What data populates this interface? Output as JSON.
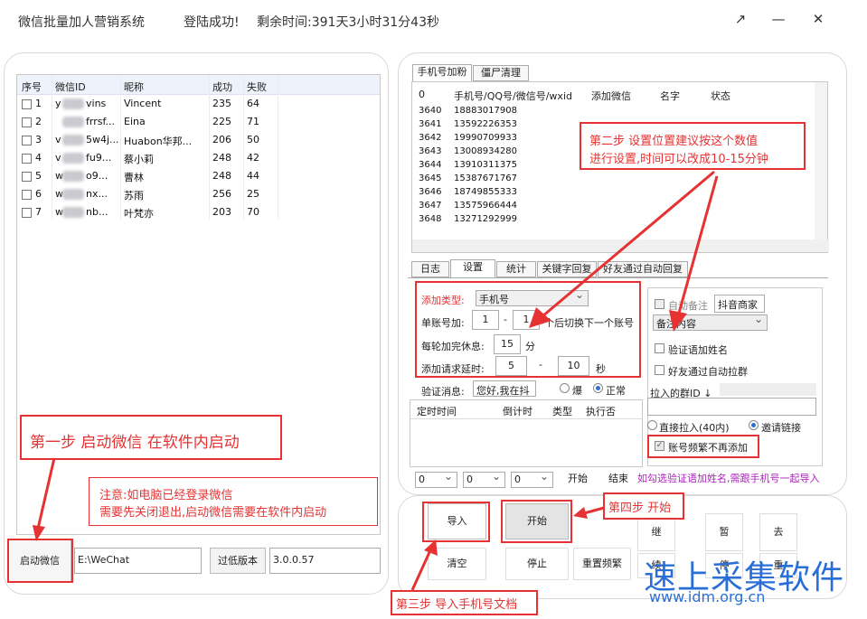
{
  "title": {
    "app": "微信批量加人营销系统",
    "login": "登陆成功!",
    "remaining": "剩余时间:391天3小时31分43秒"
  },
  "winctl": {
    "restore": "↗",
    "min": "—",
    "close": "✕"
  },
  "left_table": {
    "headers": [
      "序号",
      "微信ID",
      "昵称",
      "成功",
      "失败"
    ],
    "rows": [
      {
        "n": "1",
        "id_a": "y",
        "id_b": "vins",
        "nick": "Vincent",
        "ok": "235",
        "fail": "64"
      },
      {
        "n": "2",
        "id_a": "",
        "id_b": "frrsf...",
        "nick": "Eina",
        "ok": "225",
        "fail": "71"
      },
      {
        "n": "3",
        "id_a": "v",
        "id_b": "5w4j...",
        "nick": "Huabon华邦...",
        "ok": "206",
        "fail": "50"
      },
      {
        "n": "4",
        "id_a": "v",
        "id_b": "fu9...",
        "nick": "蔡小莉",
        "ok": "248",
        "fail": "42"
      },
      {
        "n": "5",
        "id_a": "w",
        "id_b": "o9...",
        "nick": "曹林",
        "ok": "248",
        "fail": "44"
      },
      {
        "n": "6",
        "id_a": "w",
        "id_b": "nx...",
        "nick": "苏雨",
        "ok": "256",
        "fail": "25"
      },
      {
        "n": "7",
        "id_a": "w",
        "id_b": "nb...",
        "nick": "叶梵亦",
        "ok": "203",
        "fail": "70"
      }
    ]
  },
  "left_bottom": {
    "start_wechat": "启动微信",
    "path": "E:\\WeChat",
    "low_version": "过低版本",
    "version": "3.0.0.57"
  },
  "annot": {
    "step1": "第一步 启动微信 在软件内启动",
    "note1": "注意:如电脑已经登录微信",
    "note2": "需要先关闭退出,启动微信需要在软件内启动",
    "step2a": "第二步 设置位置建议按这个数值",
    "step2b": "进行设置,时间可以改成10-15分钟",
    "step3": "第三步 导入手机号文档",
    "step4": "第四步 开始"
  },
  "top_tabs": [
    "手机号加粉",
    "僵尸清理"
  ],
  "phone_table": {
    "headers": [
      "0",
      "手机号/QQ号/微信号/wxid",
      "添加微信",
      "名字",
      "状态"
    ],
    "rows": [
      [
        "3640",
        "18883017908"
      ],
      [
        "3641",
        "13592226353"
      ],
      [
        "3642",
        "19990709933"
      ],
      [
        "3643",
        "13008934280"
      ],
      [
        "3644",
        "13910311375"
      ],
      [
        "3645",
        "15387671767"
      ],
      [
        "3646",
        "18749855333"
      ],
      [
        "3647",
        "13575966444"
      ],
      [
        "3648",
        "13271292999"
      ]
    ]
  },
  "sub_tabs": [
    "日志",
    "设置",
    "统计",
    "关键字回复",
    "好友通过自动回复"
  ],
  "settings": {
    "add_type_label": "添加类型:",
    "add_type_val": "手机号",
    "single_label": "单账号加:",
    "single_a": "1",
    "dash": "-",
    "single_b": "1",
    "switch_text": "个后切换下一个账号",
    "rest_label": "每轮加完休息:",
    "rest_val": "15",
    "rest_unit": "分",
    "delay_label": "添加请求延时:",
    "delay_a": "5",
    "delay_b": "10",
    "delay_unit": "秒",
    "verify_label": "验证消息:",
    "verify_val": "您好,我在抖",
    "radio_burst": "爆",
    "radio_normal": "正常",
    "auto_remark": "自动备注",
    "remark_val": "抖音商家",
    "remark_content": "备注内容",
    "verify_name": "验证语加姓名",
    "auto_pull": "好友通过自动拉群",
    "pull_group": "拉入的群ID ↓",
    "direct_pull": "直接拉入(40内)",
    "invite_link": "邀请链接",
    "no_add_freq": "账号频繁不再添加",
    "tip": "如勾选验证语加姓名,需跟手机号一起导入"
  },
  "schedule": {
    "headers": [
      "定时时间",
      "倒计时",
      "类型",
      "执行否"
    ],
    "sel1": "0",
    "sel2": "0",
    "sel3": "0",
    "start": "开始",
    "end": "结束"
  },
  "actions": {
    "import": "导入",
    "start": "开始",
    "resume": "继",
    "pause": "暂",
    "remove": "去",
    "clear": "清空",
    "stop": "停止",
    "reset_freq": "重置频繁",
    "b2": "续",
    "b3": "停",
    "b4": "重"
  },
  "watermark": {
    "line1": "速上采集软件",
    "line2": "www.idm.org.cn"
  },
  "colors": {
    "accent": "#e63232",
    "select": "#2a6fd6"
  }
}
